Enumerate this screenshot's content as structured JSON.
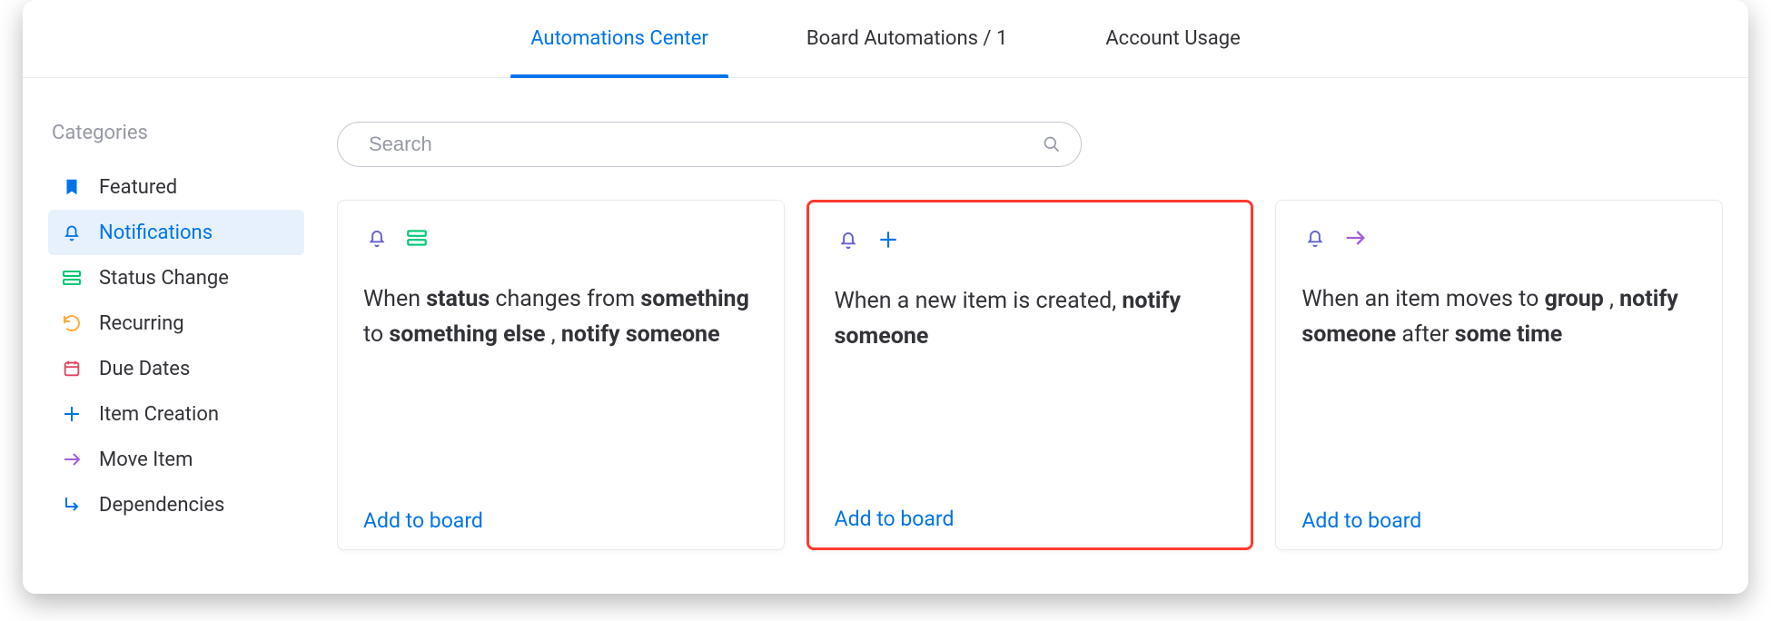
{
  "tabs": [
    {
      "label": "Automations Center",
      "active": true
    },
    {
      "label": "Board Automations / 1",
      "active": false
    },
    {
      "label": "Account Usage",
      "active": false
    }
  ],
  "sidebar": {
    "title": "Categories",
    "items": [
      {
        "label": "Featured",
        "icon": "bookmark",
        "color": "#0073ea"
      },
      {
        "label": "Notifications",
        "icon": "bell",
        "color": "#0073ea",
        "active": true
      },
      {
        "label": "Status Change",
        "icon": "status",
        "color": "#00c875"
      },
      {
        "label": "Recurring",
        "icon": "recur",
        "color": "#fdab3d"
      },
      {
        "label": "Due Dates",
        "icon": "calendar",
        "color": "#e2445c"
      },
      {
        "label": "Item Creation",
        "icon": "plus",
        "color": "#0073ea"
      },
      {
        "label": "Move Item",
        "icon": "arrow",
        "color": "#a25ddc"
      },
      {
        "label": "Dependencies",
        "icon": "dep",
        "color": "#0073ea"
      }
    ]
  },
  "search": {
    "placeholder": "Search"
  },
  "cards": [
    {
      "icon1": {
        "type": "bell",
        "color": "#6161d0"
      },
      "icon2": {
        "type": "status",
        "color": "#00c875"
      },
      "recipe": [
        {
          "t": "When ",
          "b": false
        },
        {
          "t": "status",
          "b": true
        },
        {
          "t": " changes from ",
          "b": false
        },
        {
          "t": "something",
          "b": true
        },
        {
          "t": " to ",
          "b": false
        },
        {
          "t": "something else",
          "b": true
        },
        {
          "t": " , ",
          "b": false
        },
        {
          "t": "notify someone",
          "b": true
        }
      ],
      "action": "Add to board",
      "highlight": false
    },
    {
      "icon1": {
        "type": "bell",
        "color": "#6161d0"
      },
      "icon2": {
        "type": "plus",
        "color": "#0073ea"
      },
      "recipe": [
        {
          "t": "When a new item is created, ",
          "b": false
        },
        {
          "t": "notify someone",
          "b": true
        }
      ],
      "action": "Add to board",
      "highlight": true
    },
    {
      "icon1": {
        "type": "bell",
        "color": "#6161d0"
      },
      "icon2": {
        "type": "arrow",
        "color": "#a25ddc"
      },
      "recipe": [
        {
          "t": "When an item moves to ",
          "b": false
        },
        {
          "t": "group",
          "b": true
        },
        {
          "t": " , ",
          "b": false
        },
        {
          "t": "notify someone",
          "b": true
        },
        {
          "t": " after ",
          "b": false
        },
        {
          "t": "some time",
          "b": true
        }
      ],
      "action": "Add to board",
      "highlight": false
    }
  ]
}
